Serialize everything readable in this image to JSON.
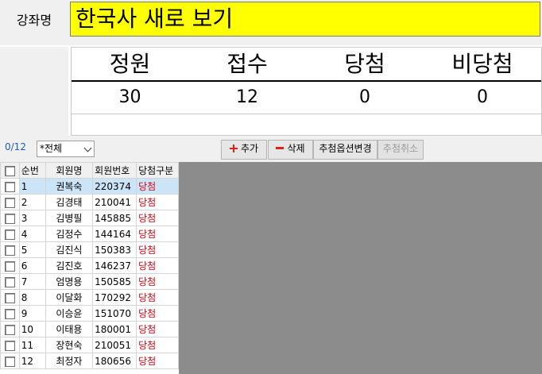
{
  "course": {
    "label": "강좌명",
    "title": "한국사 새로 보기"
  },
  "stats": {
    "headers": [
      "정원",
      "접수",
      "당첨",
      "비당첨"
    ],
    "values": [
      "30",
      "12",
      "0",
      "0"
    ]
  },
  "toolbar": {
    "count": "0/12",
    "filter_value": "*전체",
    "add_label": "추가",
    "delete_label": "삭제",
    "change_options_label": "추첨옵션변경",
    "cancel_label": "추첨취소"
  },
  "grid": {
    "columns": [
      "순번",
      "회원명",
      "회원번호",
      "당첨구분"
    ],
    "rows": [
      [
        "1",
        "권복숙",
        "220374",
        "당첨"
      ],
      [
        "2",
        "김경태",
        "210041",
        "당첨"
      ],
      [
        "3",
        "김병필",
        "145885",
        "당첨"
      ],
      [
        "4",
        "김정수",
        "144164",
        "당첨"
      ],
      [
        "5",
        "김진식",
        "150383",
        "당첨"
      ],
      [
        "6",
        "김진호",
        "146237",
        "당첨"
      ],
      [
        "7",
        "엄명용",
        "150585",
        "당첨"
      ],
      [
        "8",
        "이달화",
        "170292",
        "당첨"
      ],
      [
        "9",
        "이승윤",
        "151070",
        "당첨"
      ],
      [
        "10",
        "이태용",
        "180001",
        "당첨"
      ],
      [
        "11",
        "장현숙",
        "210051",
        "당첨"
      ],
      [
        "12",
        "최정자",
        "180656",
        "당첨"
      ]
    ]
  },
  "colors": {
    "title_bg": "#ffff00",
    "result_text": "#d4000f",
    "selected_row": "#cce4f7",
    "count_text": "#1a5fb4"
  }
}
